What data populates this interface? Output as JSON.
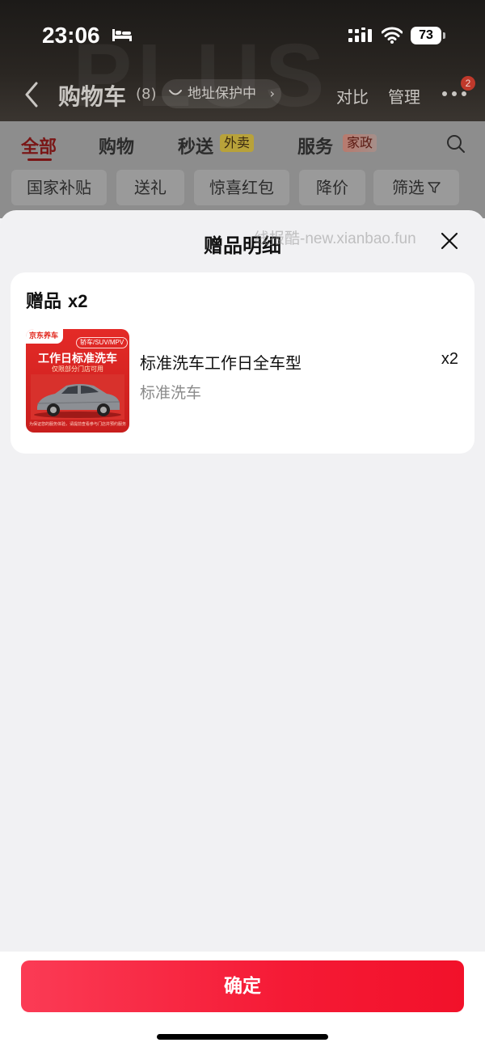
{
  "status_bar": {
    "time": "23:06",
    "battery": "73"
  },
  "nav": {
    "title": "购物车",
    "count": "(8)",
    "address_pill": "地址保护中",
    "compare": "对比",
    "manage": "管理",
    "more_badge": "2",
    "watermark": "PLUS"
  },
  "tabs": [
    {
      "label": "全部",
      "active": true
    },
    {
      "label": "购物",
      "active": false
    },
    {
      "label": "秒送",
      "badge": "外卖",
      "active": false
    },
    {
      "label": "服务",
      "badge": "家政",
      "active": false
    }
  ],
  "chips": [
    "国家补贴",
    "送礼",
    "惊喜红包",
    "降价",
    "筛选"
  ],
  "sheet": {
    "title": "赠品明细",
    "watermark": "线报酷-new.xianbao.fun",
    "gift_header_label": "赠品",
    "gift_header_count": "x2",
    "item": {
      "name": "标准洗车工作日全车型",
      "category": "标准洗车",
      "quantity": "x2",
      "thumb": {
        "brand": "京东养车",
        "tag": "轿车/SUV/MPV",
        "title": "工作日标准洗车",
        "subtitle": "仅限部分门店可用",
        "footer": "为保证您的服务体验，请提前查看参与门店并预约服务"
      }
    }
  },
  "confirm_label": "确定",
  "colors": {
    "accent": "#f51a35",
    "active_tab": "#e1251b"
  }
}
